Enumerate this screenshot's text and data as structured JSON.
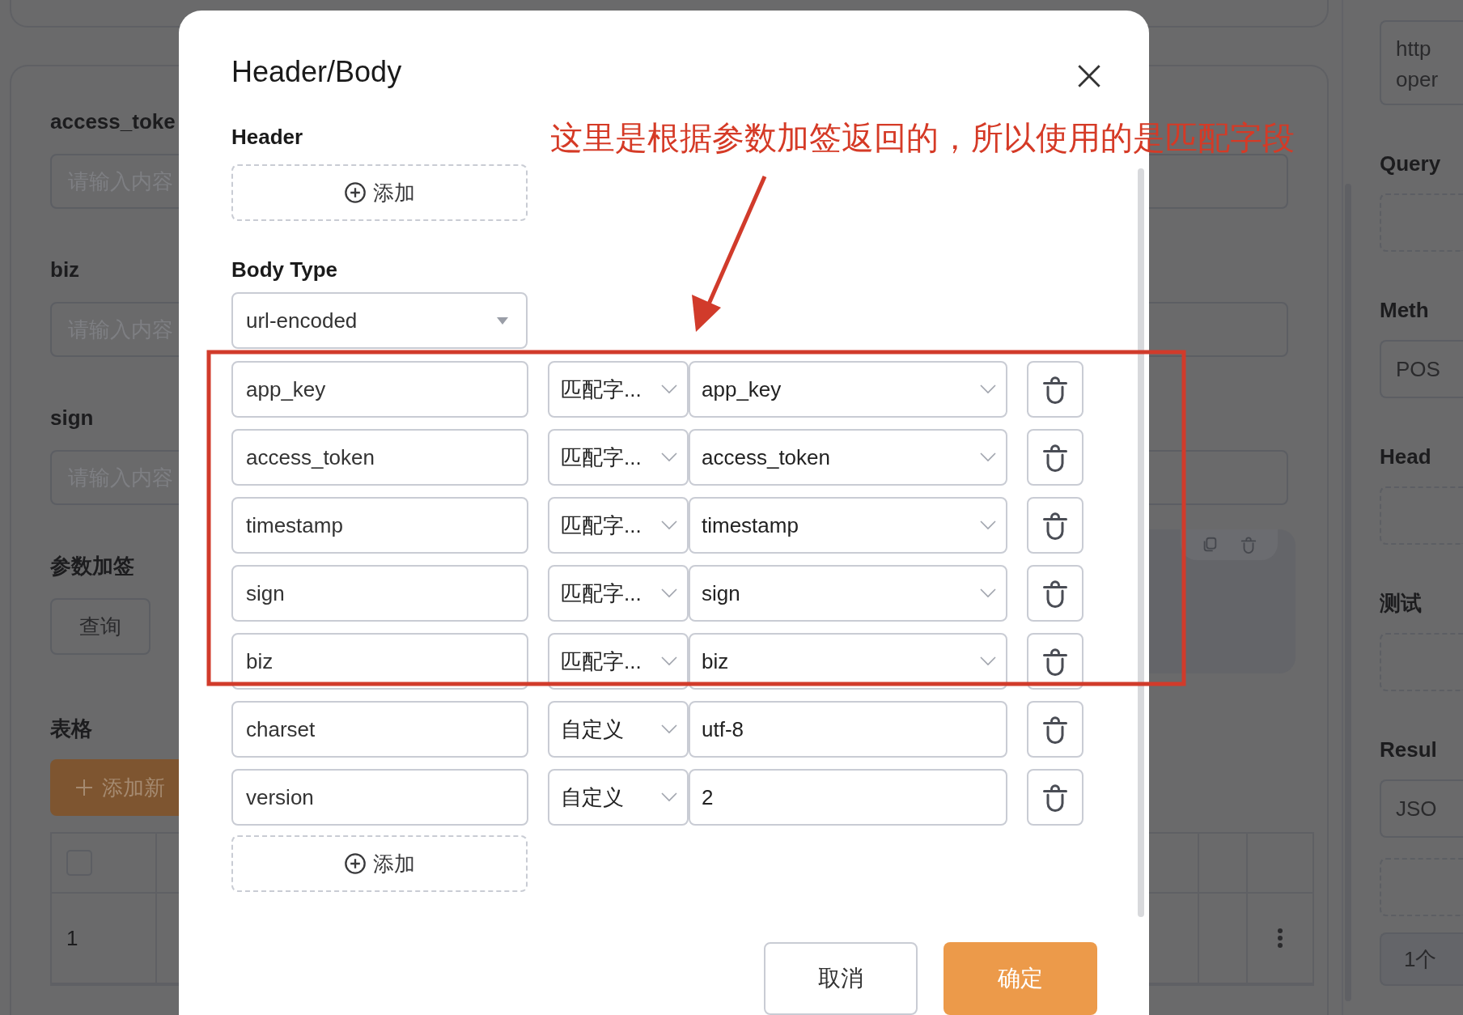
{
  "page": {
    "left_form": {
      "fields": [
        {
          "label": "access_toke",
          "placeholder": "请输入内容"
        },
        {
          "label": "biz",
          "placeholder": "请输入内容"
        },
        {
          "label": "sign",
          "placeholder": "请输入内容"
        }
      ],
      "sign_section": {
        "label": "参数加签",
        "button": "查询"
      },
      "table_section": {
        "label": "表格",
        "add_button": "添加新",
        "select_all": {
          "checked": false
        },
        "rows": [
          {
            "index": "1"
          }
        ]
      }
    },
    "right_panel": {
      "url_lines": [
        "http",
        "oper"
      ],
      "sections": [
        {
          "label": "Query",
          "kind": "dashed"
        },
        {
          "label": "Meth",
          "kind": "select",
          "value": "POS"
        },
        {
          "label": "Head",
          "kind": "dashed"
        },
        {
          "label": "测试",
          "kind": "dashed"
        },
        {
          "label": "Resul",
          "kind": "select",
          "value": "JSO"
        }
      ],
      "result_count": "1个"
    }
  },
  "dialog": {
    "title": "Header/Body",
    "header_label": "Header",
    "header_add": "添加",
    "body_type_label": "Body Type",
    "body_type": "url-encoded",
    "params": [
      {
        "name": "app_key",
        "mode": "匹配字...",
        "kind": "select",
        "value": "app_key"
      },
      {
        "name": "access_token",
        "mode": "匹配字...",
        "kind": "select",
        "value": "access_token"
      },
      {
        "name": "timestamp",
        "mode": "匹配字...",
        "kind": "select",
        "value": "timestamp"
      },
      {
        "name": "sign",
        "mode": "匹配字...",
        "kind": "select",
        "value": "sign"
      },
      {
        "name": "biz",
        "mode": "匹配字...",
        "kind": "select",
        "value": "biz"
      },
      {
        "name": "charset",
        "mode": "自定义",
        "kind": "input",
        "value": "utf-8"
      },
      {
        "name": "version",
        "mode": "自定义",
        "kind": "input",
        "value": "2"
      }
    ],
    "body_add": "添加",
    "cancel": "取消",
    "confirm": "确定"
  },
  "annotation": {
    "text": "这里是根据参数加签返回的，所以使用的是匹配字段"
  }
}
